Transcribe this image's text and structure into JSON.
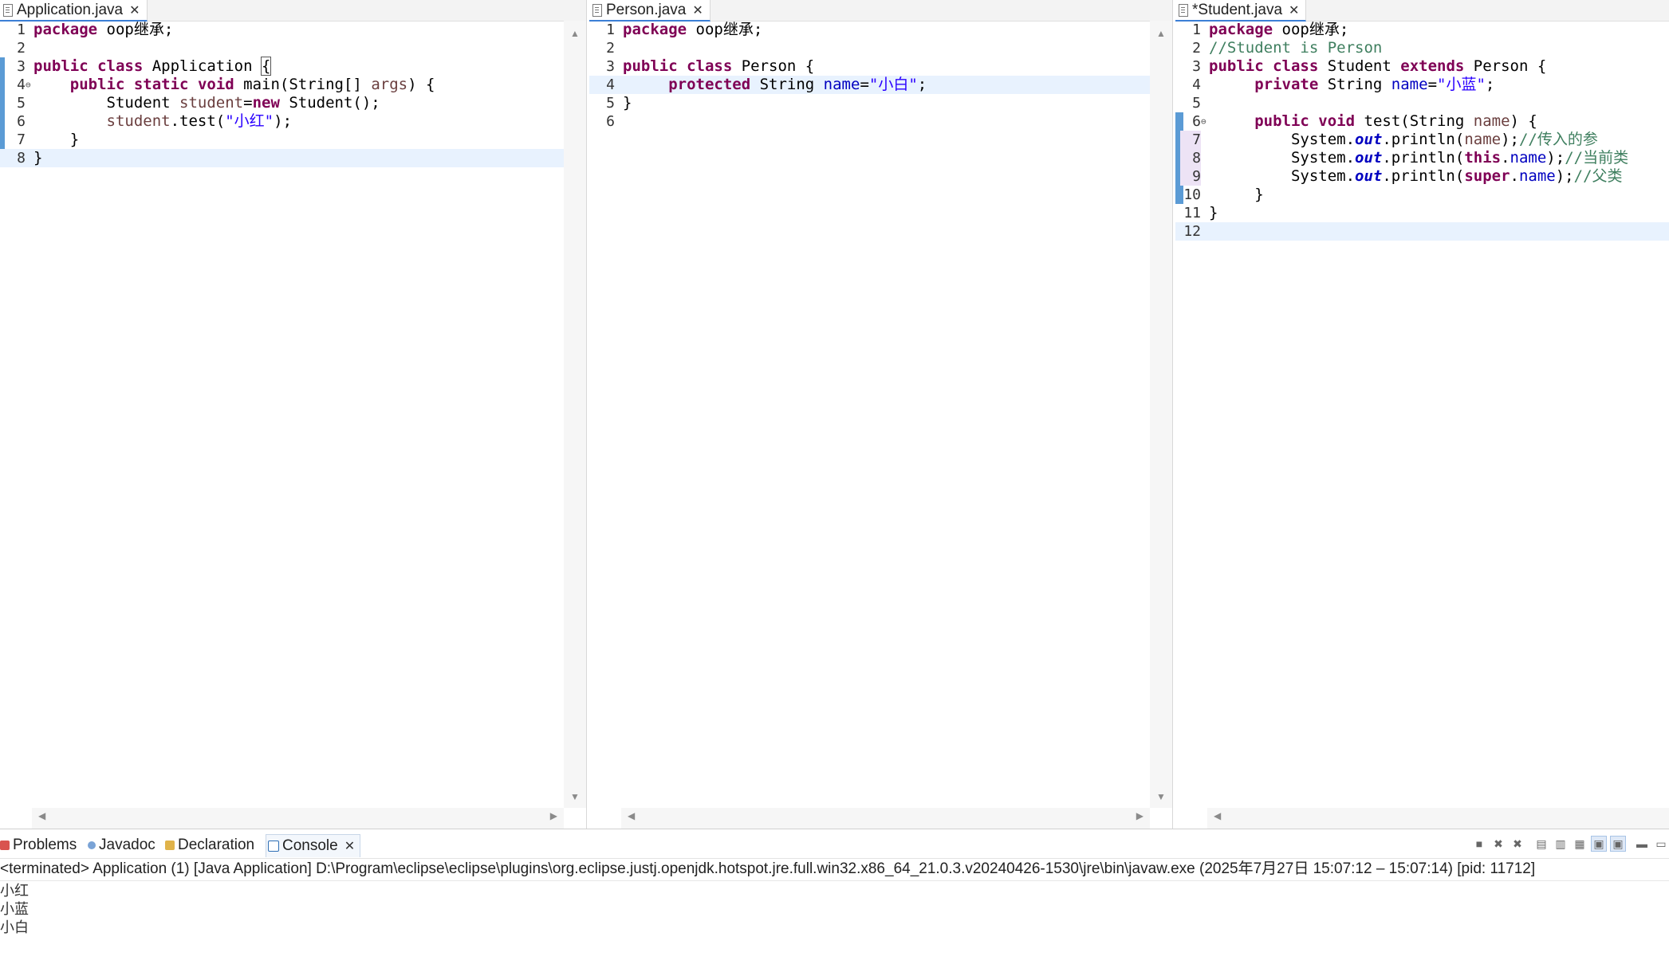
{
  "editors": [
    {
      "tab": "Application.java",
      "lines": [
        "1",
        "2",
        "3",
        "4",
        "5",
        "6",
        "7",
        "8"
      ]
    },
    {
      "tab": "Person.java",
      "lines": [
        "1",
        "2",
        "3",
        "4",
        "5",
        "6"
      ]
    },
    {
      "tab": "*Student.java",
      "lines": [
        "1",
        "2",
        "3",
        "4",
        "5",
        "6",
        "7",
        "8",
        "9",
        "10",
        "11",
        "12"
      ]
    }
  ],
  "code": {
    "app": {
      "l1": [
        "package",
        " oop继承;"
      ],
      "l3": [
        "public",
        "class",
        " Application ",
        "{"
      ],
      "l4": [
        "public",
        "static",
        "void",
        " main(String[] ",
        "args",
        ") {"
      ],
      "l5": [
        "Student ",
        "student",
        "=",
        "new",
        " Student();"
      ],
      "l6": [
        "student",
        ".test(",
        "\"小红\"",
        ");"
      ],
      "l7": "}",
      "l8": "}"
    },
    "person": {
      "l1": [
        "package",
        " oop继承;"
      ],
      "l3": [
        "public",
        "class",
        " Person {"
      ],
      "l4": [
        "protected",
        " String ",
        "name",
        "=",
        "\"小白\"",
        ";"
      ],
      "l5": "}"
    },
    "student": {
      "l1": [
        "package",
        " oop继承;"
      ],
      "l2": "//Student is Person",
      "l3": [
        "public",
        "class",
        " Student ",
        "extends",
        " Person {"
      ],
      "l4": [
        "private",
        " String ",
        "name",
        "=",
        "\"小蓝\"",
        ";"
      ],
      "l6": [
        "public",
        "void",
        " test(String ",
        "name",
        ") {"
      ],
      "l7": [
        "System.",
        "out",
        ".println(",
        "name",
        ");",
        "//传入的参"
      ],
      "l8": [
        "System.",
        "out",
        ".println(",
        "this",
        ".",
        "name",
        ");",
        "//当前类"
      ],
      "l9": [
        "System.",
        "out",
        ".println(",
        "super",
        ".",
        "name",
        ");",
        "//父类"
      ],
      "l10": "}",
      "l11": "}"
    }
  },
  "console": {
    "tabs": [
      "Problems",
      "Javadoc",
      "Declaration",
      "Console"
    ],
    "header": "<terminated> Application (1) [Java Application] D:\\Program\\eclipse\\eclipse\\plugins\\org.eclipse.justj.openjdk.hotspot.jre.full.win32.x86_64_21.0.3.v20240426-1530\\jre\\bin\\javaw.exe  (2025年7月27日 15:07:12 – 15:07:14) [pid: 11712]",
    "output": [
      "小红",
      "小蓝",
      "小白"
    ]
  },
  "colors": {
    "keyword": "#7f0055",
    "string": "#2a00ff",
    "field": "#0000c0",
    "comment": "#3f7f5f",
    "current_line": "#e8f2fe",
    "change_bar": "#5b9bd5"
  }
}
